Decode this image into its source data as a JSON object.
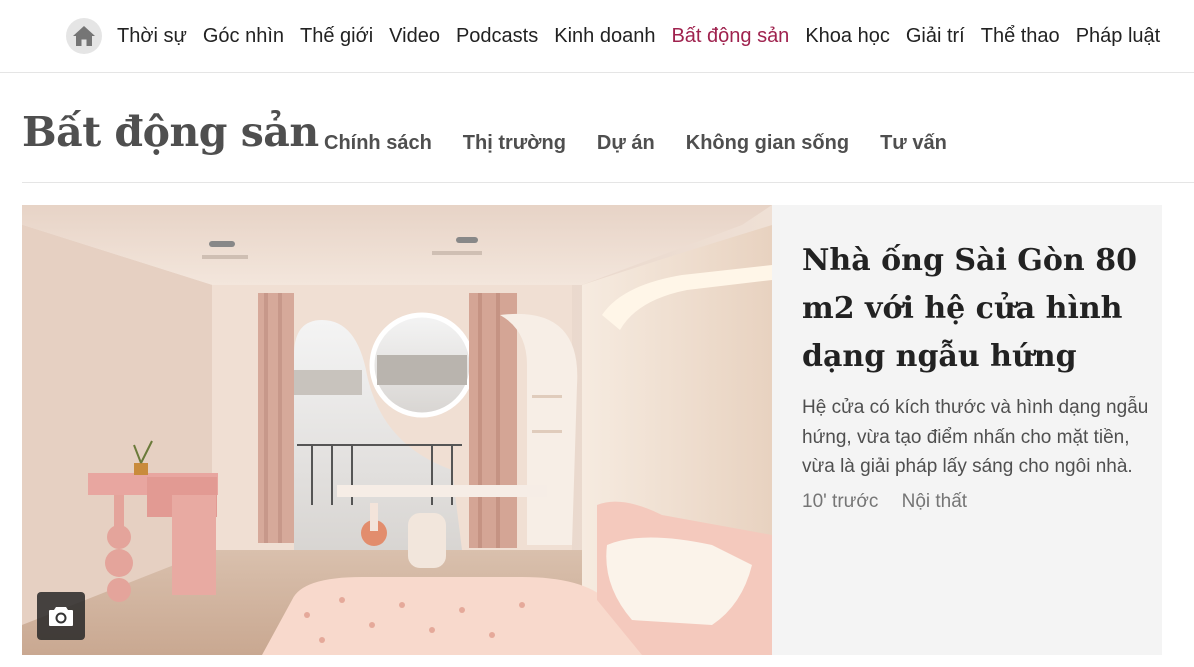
{
  "nav": {
    "home_icon": "home-icon",
    "items": [
      {
        "label": "Thời sự"
      },
      {
        "label": "Góc nhìn"
      },
      {
        "label": "Thế giới"
      },
      {
        "label": "Video"
      },
      {
        "label": "Podcasts"
      },
      {
        "label": "Kinh doanh"
      },
      {
        "label": "Bất động sản",
        "active": true
      },
      {
        "label": "Khoa học"
      },
      {
        "label": "Giải trí"
      },
      {
        "label": "Thể thao"
      },
      {
        "label": "Pháp luật"
      }
    ],
    "active_color": "#9f224e"
  },
  "section": {
    "title": "Bất động sản",
    "subnav": [
      "Chính sách",
      "Thị trường",
      "Dự án",
      "Không gian sống",
      "Tư vấn"
    ]
  },
  "featured": {
    "headline": "Nhà ống Sài Gòn 80 m2 với hệ cửa hình dạng ngẫu hứng",
    "lead": "Hệ cửa có kích thước và hình dạng ngẫu hứng, vừa tạo điểm nhấn cho mặt tiền, vừa là giải pháp lấy sáng cho ngôi nhà.",
    "time": "10' trước",
    "category": "Nội thất",
    "photo_icon": "camera-icon"
  }
}
